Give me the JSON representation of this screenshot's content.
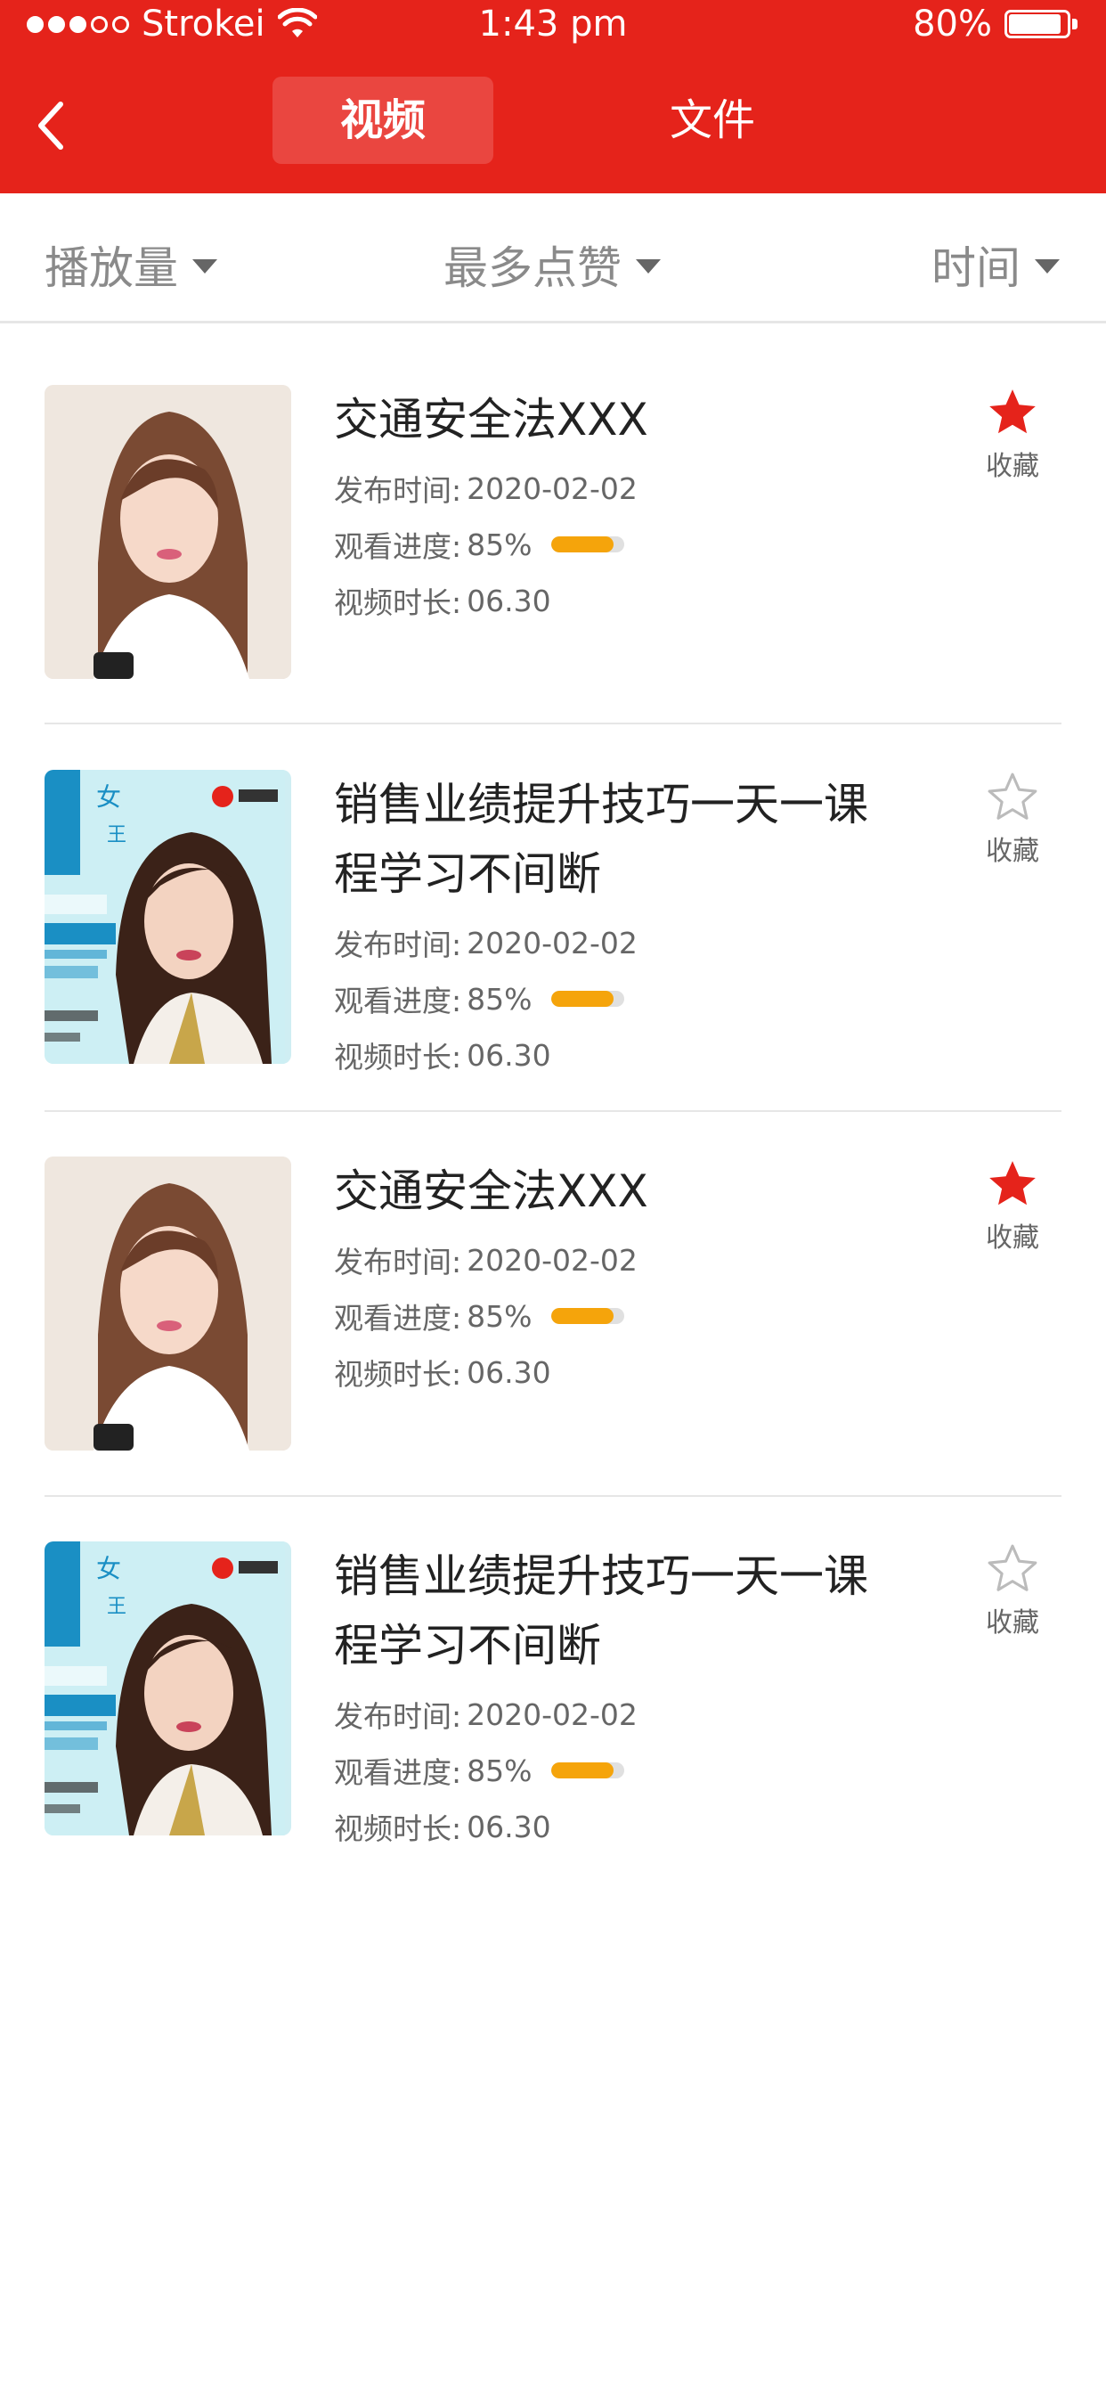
{
  "status_bar": {
    "carrier": "Strokei",
    "time": "1:43 pm",
    "battery": "80%"
  },
  "header": {
    "tabs": [
      {
        "label": "视频",
        "active": true
      },
      {
        "label": "文件",
        "active": false
      }
    ]
  },
  "filters": [
    {
      "label": "播放量"
    },
    {
      "label": "最多点赞"
    },
    {
      "label": "时间"
    }
  ],
  "items": [
    {
      "title": "交通安全法XXX",
      "publish_label": "发布时间:",
      "publish_date": "2020-02-02",
      "progress_label": "观看进度:",
      "progress_text": "85%",
      "progress_value": 0.85,
      "duration_label": "视频时长:",
      "duration": "06.30",
      "favorited": true,
      "fav_label": "收藏"
    },
    {
      "title": "销售业绩提升技巧一天一课程学习不间断",
      "publish_label": "发布时间:",
      "publish_date": "2020-02-02",
      "progress_label": "观看进度:",
      "progress_text": "85%",
      "progress_value": 0.85,
      "duration_label": "视频时长:",
      "duration": "06.30",
      "favorited": false,
      "fav_label": "收藏"
    },
    {
      "title": "交通安全法XXX",
      "publish_label": "发布时间:",
      "publish_date": "2020-02-02",
      "progress_label": "观看进度:",
      "progress_text": "85%",
      "progress_value": 0.85,
      "duration_label": "视频时长:",
      "duration": "06.30",
      "favorited": true,
      "fav_label": "收藏"
    },
    {
      "title": "销售业绩提升技巧一天一课程学习不间断",
      "publish_label": "发布时间:",
      "publish_date": "2020-02-02",
      "progress_label": "观看进度:",
      "progress_text": "85%",
      "progress_value": 0.85,
      "duration_label": "视频时长:",
      "duration": "06.30",
      "favorited": false,
      "fav_label": "收藏"
    }
  ],
  "colors": {
    "brand": "#e5231b",
    "progress": "#f5a40b",
    "star_active": "#e5231b",
    "star_inactive": "#bbbbbb"
  }
}
